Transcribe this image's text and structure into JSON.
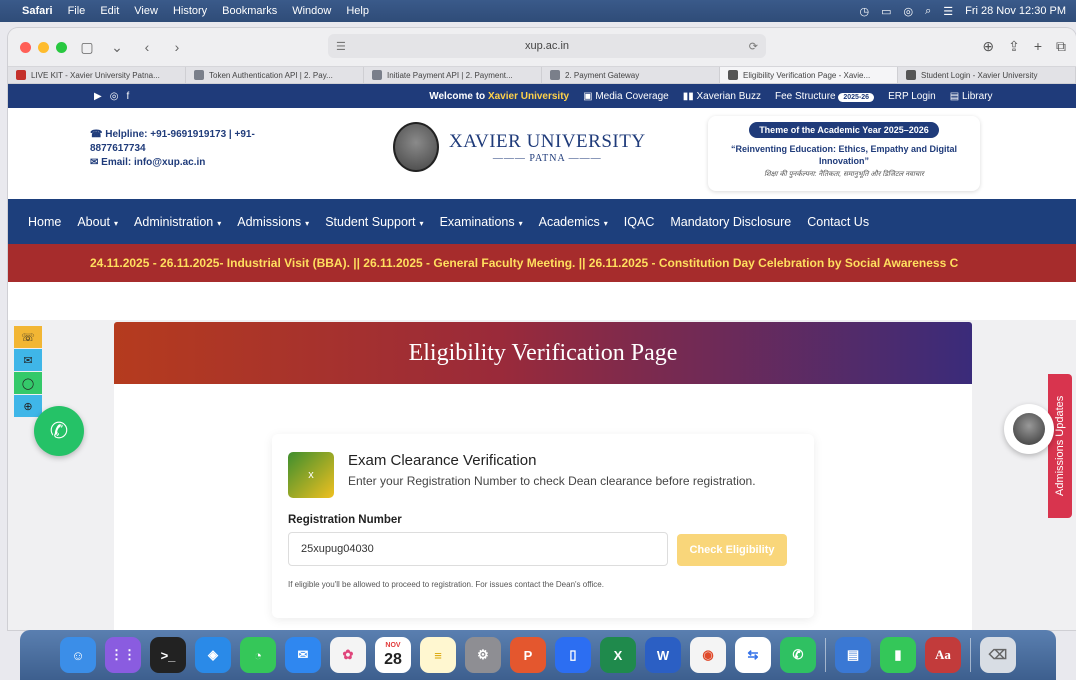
{
  "menubar": {
    "app": "Safari",
    "items": [
      "File",
      "Edit",
      "View",
      "History",
      "Bookmarks",
      "Window",
      "Help"
    ],
    "clock": "Fri 28 Nov  12:30 PM"
  },
  "browser": {
    "url": "xup.ac.in",
    "tabs": [
      "LIVE KIT - Xavier University Patna...",
      "Token Authentication API | 2. Pay...",
      "Initiate Payment API | 2. Payment...",
      "2. Payment Gateway",
      "Eligibility Verification Page - Xavie...",
      "Student Login - Xavier University"
    ]
  },
  "topstrip": {
    "welcome": "Welcome to",
    "welcome_hl": "Xavier University",
    "media": "Media Coverage",
    "buzz": "Xaverian Buzz",
    "fee": "Fee Structure",
    "fee_badge": "2025-26",
    "erp": "ERP Login",
    "library": "Library"
  },
  "header": {
    "helpline": "Helpline: +91-9691919173 | +91-",
    "helpline2": "8877617734",
    "email": "Email: info@xup.ac.in",
    "university": "XAVIER UNIVERSITY",
    "city": "PATNA",
    "theme_pill": "Theme of the Academic Year 2025–2026",
    "theme_quote": "“Reinventing Education: Ethics, Empathy and Digital Innovation”",
    "theme_hindi": "शिक्षा की पुनर्कल्पना: नैतिकता, समानुभूति और डिजिटल नवाचार"
  },
  "nav": {
    "items": [
      "Home",
      "About",
      "Administration",
      "Admissions",
      "Student Support",
      "Examinations",
      "Academics",
      "IQAC",
      "Mandatory Disclosure",
      "Contact Us"
    ]
  },
  "ticker": {
    "text": "24.11.2025 - 26.11.2025- Industrial Visit (BBA).  ||  26.11.2025 - General Faculty Meeting.  ||  26.11.2025 - Constitution Day Celebration by Social Awareness C"
  },
  "page": {
    "banner_title": "Eligibility Verification Page",
    "side_tab": "Admissions Updates"
  },
  "card": {
    "icon_letter": "x",
    "title": "Exam Clearance Verification",
    "subtitle": "Enter your Registration Number to check Dean clearance before registration.",
    "field_label": "Registration Number",
    "field_value": "25xupug04030",
    "button": "Check Eligibility",
    "note": "If eligible you'll be allowed to proceed to registration. For issues contact the Dean's office."
  },
  "dock": {
    "calendar_month": "NOV",
    "calendar_day": "28"
  }
}
